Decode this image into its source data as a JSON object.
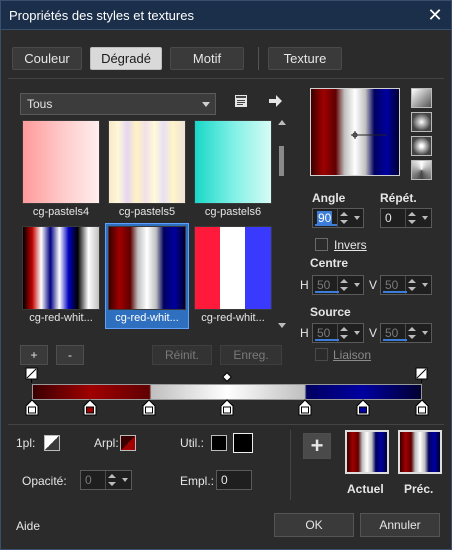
{
  "window": {
    "title": "Propriétés des styles et textures",
    "close": "✕"
  },
  "tabs": [
    {
      "label": "Couleur"
    },
    {
      "label": "Dégradé"
    },
    {
      "label": "Motif"
    },
    {
      "label": "Texture"
    }
  ],
  "gradient_list": {
    "category": "Tous",
    "items": [
      {
        "label": "cg-pastels4"
      },
      {
        "label": "cg-pastels5"
      },
      {
        "label": "cg-pastels6"
      },
      {
        "label": "cg-red-whit..."
      },
      {
        "label": "cg-red-whit..."
      },
      {
        "label": "cg-red-whit..."
      }
    ],
    "selected_index": 4
  },
  "list_buttons": {
    "add": "+",
    "remove": "-",
    "reset": "Réinit.",
    "save": "Enreg."
  },
  "properties": {
    "angle_label": "Angle",
    "angle_value": "90",
    "repeat_label": "Répét.",
    "repeat_value": "0",
    "invert_label": "Invers",
    "center_label": "Centre",
    "center_h_label": "H",
    "center_h_value": "50",
    "center_v_label": "V",
    "center_v_value": "50",
    "source_label": "Source",
    "source_h_label": "H",
    "source_h_value": "50",
    "source_v_label": "V",
    "source_v_value": "50",
    "link_label": "Liaison"
  },
  "stop_controls": {
    "fg_label": "1pl:",
    "bg_label": "Arpl:",
    "user_label": "Util.:",
    "opacity_label": "Opacité:",
    "opacity_value": "0",
    "location_label": "Empl.:",
    "location_value": "0"
  },
  "bottom": {
    "current_label": "Actuel",
    "previous_label": "Préc.",
    "add_glyph": "+",
    "help": "Aide",
    "ok": "OK",
    "cancel": "Annuler"
  },
  "colors": {
    "dark_red": "#8b0000",
    "white": "#ffffff",
    "navy": "#000080",
    "selection": "#2f6fbf",
    "accent": "#3d7dd8"
  }
}
